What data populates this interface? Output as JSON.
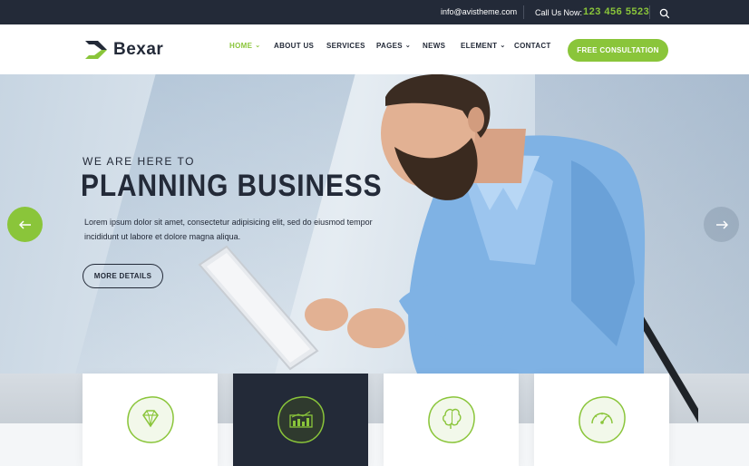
{
  "topbar": {
    "email": "info@avistheme.com",
    "call_label": "Call Us Now:",
    "call_number": "123 456 5523",
    "search_icon": "search-icon"
  },
  "header": {
    "brand": "Bexar",
    "nav": [
      {
        "label": "HOME",
        "dropdown": true,
        "active": true
      },
      {
        "label": "ABOUT US",
        "dropdown": false
      },
      {
        "label": "SERVICES",
        "dropdown": false
      },
      {
        "label": "PAGES",
        "dropdown": true
      },
      {
        "label": "NEWS",
        "dropdown": false
      },
      {
        "label": "ELEMENT",
        "dropdown": true
      },
      {
        "label": "CONTACT",
        "dropdown": false
      }
    ],
    "cta_label": "FREE CONSULTATION"
  },
  "hero": {
    "subtitle": "WE ARE HERE TO",
    "title": "PLANNING BUSINESS",
    "text": "Lorem ipsum dolor sit amet, consectetur adipisicing elit, sed do eiusmod tempor incididunt ut labore et dolore magna aliqua.",
    "button_label": "MORE DETAILS",
    "prev_icon": "arrow-left-icon",
    "next_icon": "arrow-right-icon"
  },
  "features": [
    {
      "icon": "diamond-icon",
      "selected": false
    },
    {
      "icon": "bar-chart-icon",
      "selected": true
    },
    {
      "icon": "brain-icon",
      "selected": false
    },
    {
      "icon": "speedometer-icon",
      "selected": false
    }
  ],
  "colors": {
    "accent": "#8ac53a",
    "dark": "#232a38"
  }
}
